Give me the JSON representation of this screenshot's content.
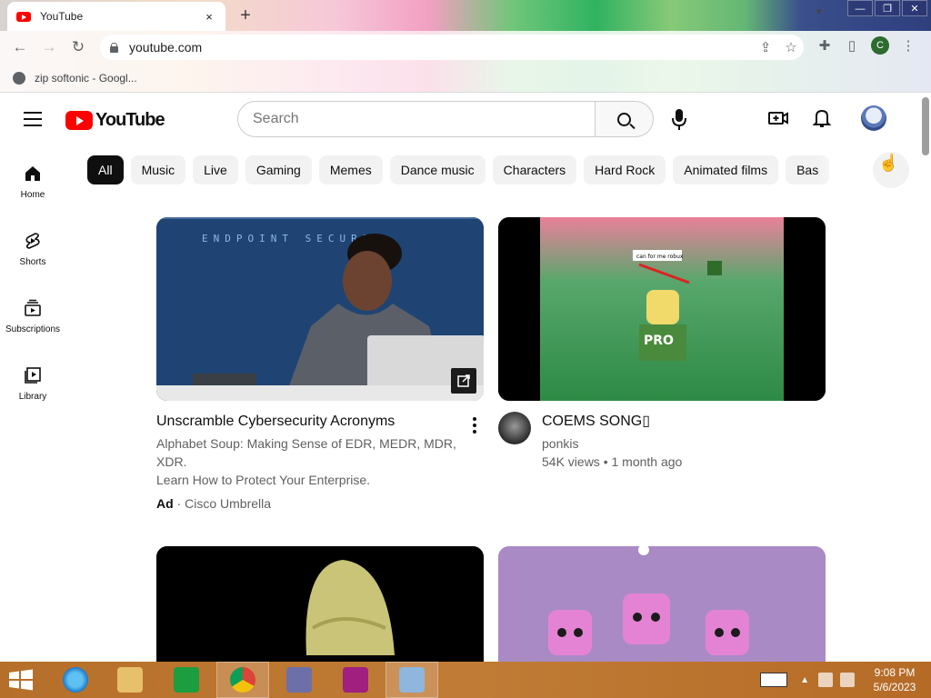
{
  "browser": {
    "tab_title": "YouTube",
    "tab_close": "×",
    "new_tab": "+",
    "url": "youtube.com",
    "bookmark": "zip softonic - Googl...",
    "profile_initial": "C",
    "window_controls": [
      "—",
      "❐",
      "✕"
    ]
  },
  "youtube": {
    "logo_text": "YouTube",
    "search_placeholder": "Search",
    "sidebar": [
      {
        "label": "Home",
        "icon": "home-icon"
      },
      {
        "label": "Shorts",
        "icon": "shorts-icon"
      },
      {
        "label": "Subscriptions",
        "icon": "subscriptions-icon"
      },
      {
        "label": "Library",
        "icon": "library-icon"
      }
    ],
    "chips": [
      "All",
      "Music",
      "Live",
      "Gaming",
      "Memes",
      "Dance music",
      "Characters",
      "Hard Rock",
      "Animated films",
      "Bas"
    ],
    "videos": [
      {
        "title": "Unscramble Cybersecurity Acronyms",
        "desc1": "Alphabet Soup: Making Sense of EDR, MEDR, MDR, XDR.",
        "desc2": "Learn How to Protect Your Enterprise.",
        "ad_label": "Ad",
        "channel": "Cisco Umbrella",
        "thumb_text": "ENDPOINT SECUREX"
      },
      {
        "title": "COEMS SONG▯",
        "channel": "ponkis",
        "stats": "54K views • 1 month ago",
        "thumb_text": "PRO",
        "thumb_caption": "can for me robux"
      }
    ]
  },
  "taskbar": {
    "time": "9:08 PM",
    "date": "5/6/2023"
  },
  "colors": {
    "yt_red": "#ff0000",
    "text_primary": "#0f0f0f",
    "text_secondary": "#606060",
    "chip_bg": "#f2f2f2",
    "taskbar": "#c07c36"
  }
}
